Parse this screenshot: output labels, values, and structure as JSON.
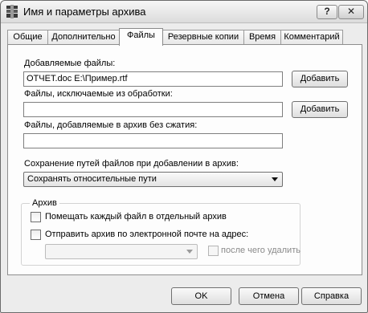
{
  "window": {
    "title": "Имя и параметры архива",
    "help_label": "?",
    "close_label": "✕"
  },
  "tabs": [
    {
      "label": "Общие"
    },
    {
      "label": "Дополнительно"
    },
    {
      "label": "Файлы",
      "active": true
    },
    {
      "label": "Резервные копии"
    },
    {
      "label": "Время"
    },
    {
      "label": "Комментарий"
    }
  ],
  "files": {
    "added_label": "Добавляемые файлы:",
    "added_value": "ОТЧЕТ.doc E:\\Пример.rtf",
    "added_button": "Добавить",
    "excluded_label": "Файлы, исключаемые из обработки:",
    "excluded_value": "",
    "excluded_button": "Добавить",
    "nocompress_label": "Файлы, добавляемые в архив без сжатия:",
    "nocompress_value": "",
    "paths_label": "Сохранение путей файлов при добавлении в архив:",
    "paths_selected": "Сохранять относительные пути"
  },
  "archive_group": {
    "title": "Архив",
    "separate_archive_label": "Помещать каждый файл в отдельный архив",
    "separate_archive_checked": false,
    "email_label": "Отправить архив по электронной почте на адрес:",
    "email_checked": false,
    "email_value": "",
    "delete_after_label": "после чего удалить",
    "delete_after_checked": false
  },
  "footer": {
    "ok": "OK",
    "cancel": "Отмена",
    "help": "Справка"
  }
}
